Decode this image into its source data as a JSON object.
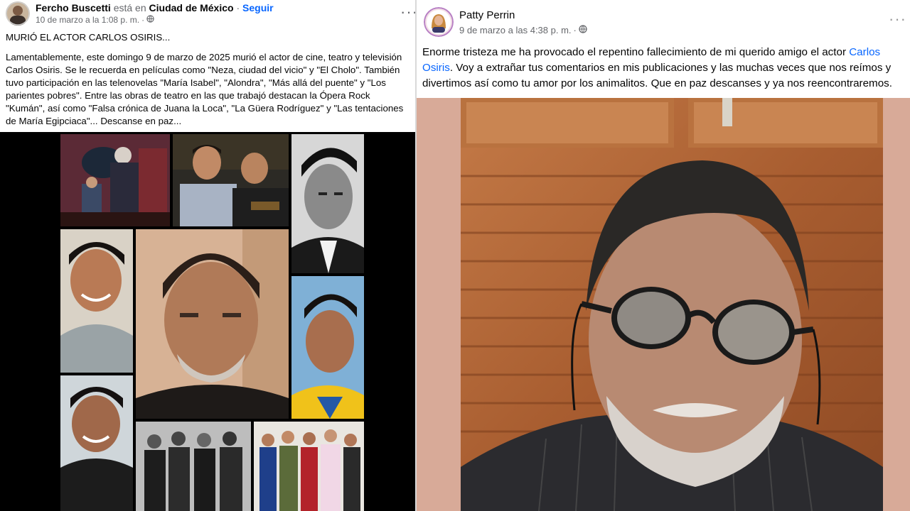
{
  "left_post": {
    "author": "Fercho Buscetti",
    "is_at": "está en",
    "location": "Ciudad de México",
    "separator": "·",
    "follow": "Seguir",
    "timestamp": "10 de marzo a la 1:08 p. m.",
    "timestamp_sep": "·",
    "headline": "MURIÓ EL ACTOR CARLOS OSIRIS...",
    "body": "Lamentablemente, este domingo 9 de marzo de 2025 murió el actor de cine, teatro y televisión Carlos Osiris. Se le recuerda en películas como \"Neza, ciudad del vicio\" y \"El Cholo\". También tuvo participación en las telenovelas \"María Isabel\", \"Alondra\", \"Más allá del puente\" y \"Los parientes pobres\". Entre las obras de teatro en las que trabajó destacan la Ópera Rock \"Kumán\", así como \"Falsa crónica de Juana la Loca\", \"La Güera Rodríguez\" y \"Las tentaciones de María Egipciaca\"... Descanse en paz...",
    "more_icon": "more-horizontal-icon",
    "privacy_icon": "globe-icon"
  },
  "right_post": {
    "author": "Patty Perrin",
    "timestamp": "9 de marzo a las 4:38 p. m.",
    "timestamp_sep": "·",
    "body_before": "Enorme tristeza me ha provocado el repentino fallecimiento de mi querido amigo el actor ",
    "mention": "Carlos Osiris",
    "body_after": ". Voy a extrañar tus comentarios en mis publicaciones y las muchas veces que nos reímos y divertimos así como tu amor por los animalitos. Que en paz descanses y ya nos reencontraremos.",
    "more_icon": "more-horizontal-icon",
    "privacy_icon": "globe-icon"
  },
  "colors": {
    "link": "#0866ff",
    "muted": "#65676b",
    "text": "#050505",
    "photo_border": "#d8aa98",
    "wood": "#b0683a"
  }
}
